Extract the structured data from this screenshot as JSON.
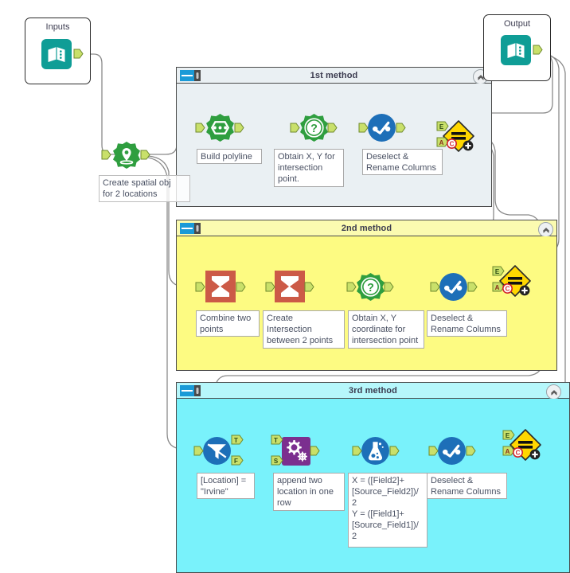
{
  "app": {
    "name": "workflow-canvas",
    "background": "#ffffff"
  },
  "colors": {
    "container_1_fill": "#eaf0f3",
    "container_2_fill": "#fdfb82",
    "container_3_fill": "#79f2fb",
    "container_border": "#4a4a4a",
    "wire": "#8a8a8a",
    "port_green": "#c9e06a",
    "spatial_green": "#2f9e3f",
    "select_blue": "#1d6fb8",
    "summarize_red": "#cc5a47",
    "append_purple": "#7b2f8f",
    "macro_teal": "#0f9d96",
    "join_yellow": "#ffd700",
    "warn_red": "#d2232a"
  },
  "inputs_container": {
    "title": "Inputs",
    "icon": "macro-book-icon",
    "output_port": "output-anchor"
  },
  "output_container": {
    "title": "Output",
    "icon": "macro-book-icon",
    "output_port": "output-anchor"
  },
  "spatial_tool": {
    "icon": "create-points-icon",
    "annotation": "Create spatial obj\nfor 2 locations"
  },
  "containers": [
    {
      "id": "method-1",
      "title": "1st method",
      "fill": "#eaf0f3",
      "collapse_icon": "chevron-up-icon",
      "badge_icon": "container-tool-icon",
      "tools": [
        {
          "id": "poly-build",
          "icon": "poly-build-icon",
          "annotation": "Build polyline"
        },
        {
          "id": "spatial-info",
          "icon": "spatial-info-icon",
          "annotation": "Obtain X, Y for\nintersection\npoint."
        },
        {
          "id": "select",
          "icon": "select-icon",
          "annotation": "Deselect &\nRename Columns"
        },
        {
          "id": "join",
          "icon": "join-icon",
          "annotation": "",
          "inputs": [
            "E",
            "A"
          ],
          "badges": [
            "warning-c-badge",
            "plus-badge"
          ]
        }
      ]
    },
    {
      "id": "method-2",
      "title": "2nd method",
      "fill": "#fdfb82",
      "collapse_icon": "chevron-up-icon",
      "badge_icon": "container-tool-icon",
      "tools": [
        {
          "id": "summarize-1",
          "icon": "summarize-icon",
          "annotation": "Combine two\npoints"
        },
        {
          "id": "summarize-2",
          "icon": "summarize-icon",
          "annotation": "Create\nIntersection\nbetween 2 points"
        },
        {
          "id": "spatial-info",
          "icon": "spatial-info-icon",
          "annotation": "Obtain X, Y\ncoordinate for\nintersection point"
        },
        {
          "id": "select",
          "icon": "select-icon",
          "annotation": "Deselect &\nRename Columns"
        },
        {
          "id": "join",
          "icon": "join-icon",
          "annotation": "",
          "inputs": [
            "E",
            "A"
          ],
          "badges": [
            "warning-c-badge",
            "plus-badge"
          ]
        }
      ]
    },
    {
      "id": "method-3",
      "title": "3rd method",
      "fill": "#79f2fb",
      "collapse_icon": "chevron-up-icon",
      "badge_icon": "container-tool-icon",
      "tools": [
        {
          "id": "filter",
          "icon": "filter-icon",
          "annotation": "[Location] =\n\"Irvine\"",
          "outputs": [
            "T",
            "F"
          ]
        },
        {
          "id": "append",
          "icon": "append-fields-icon",
          "annotation": "append two\nlocation in one\nrow",
          "inputs": [
            "T",
            "S"
          ]
        },
        {
          "id": "formula",
          "icon": "formula-icon",
          "annotation": "X = ([Field2]+\n[Source_Field2])/\n2\nY = ([Field1]+\n[Source_Field1])/\n2"
        },
        {
          "id": "select",
          "icon": "select-icon",
          "annotation": "Deselect &\nRename Columns"
        },
        {
          "id": "join",
          "icon": "join-icon",
          "annotation": "",
          "inputs": [
            "E",
            "A"
          ],
          "badges": [
            "warning-c-badge",
            "plus-badge"
          ]
        }
      ]
    }
  ],
  "port_labels": {
    "E": "E",
    "A": "A",
    "T": "T",
    "F": "F",
    "S": "S",
    "C": "C"
  }
}
